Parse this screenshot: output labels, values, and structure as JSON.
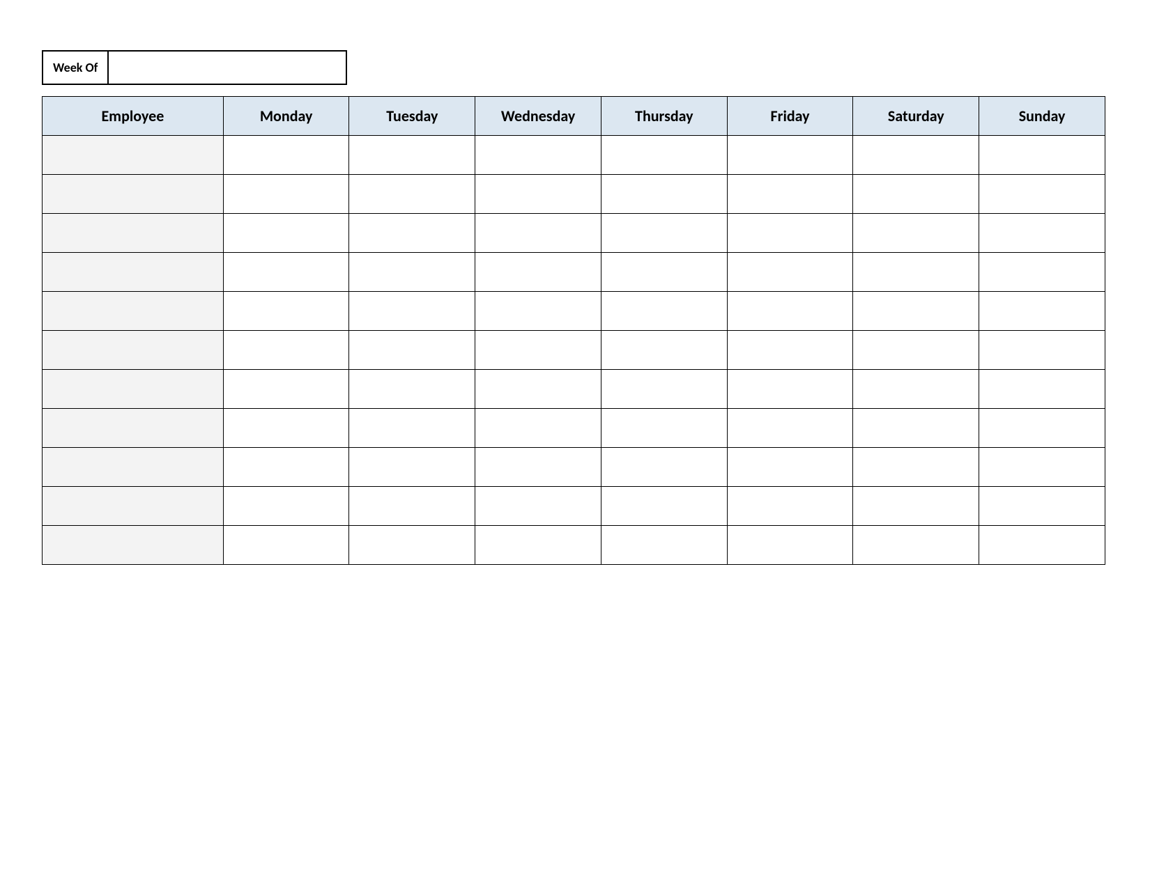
{
  "week_of": {
    "label": "Week Of",
    "value": ""
  },
  "columns": [
    "Employee",
    "Monday",
    "Tuesday",
    "Wednesday",
    "Thursday",
    "Friday",
    "Saturday",
    "Sunday"
  ],
  "rows": [
    {
      "employee": "",
      "monday": "",
      "tuesday": "",
      "wednesday": "",
      "thursday": "",
      "friday": "",
      "saturday": "",
      "sunday": ""
    },
    {
      "employee": "",
      "monday": "",
      "tuesday": "",
      "wednesday": "",
      "thursday": "",
      "friday": "",
      "saturday": "",
      "sunday": ""
    },
    {
      "employee": "",
      "monday": "",
      "tuesday": "",
      "wednesday": "",
      "thursday": "",
      "friday": "",
      "saturday": "",
      "sunday": ""
    },
    {
      "employee": "",
      "monday": "",
      "tuesday": "",
      "wednesday": "",
      "thursday": "",
      "friday": "",
      "saturday": "",
      "sunday": ""
    },
    {
      "employee": "",
      "monday": "",
      "tuesday": "",
      "wednesday": "",
      "thursday": "",
      "friday": "",
      "saturday": "",
      "sunday": ""
    },
    {
      "employee": "",
      "monday": "",
      "tuesday": "",
      "wednesday": "",
      "thursday": "",
      "friday": "",
      "saturday": "",
      "sunday": ""
    },
    {
      "employee": "",
      "monday": "",
      "tuesday": "",
      "wednesday": "",
      "thursday": "",
      "friday": "",
      "saturday": "",
      "sunday": ""
    },
    {
      "employee": "",
      "monday": "",
      "tuesday": "",
      "wednesday": "",
      "thursday": "",
      "friday": "",
      "saturday": "",
      "sunday": ""
    },
    {
      "employee": "",
      "monday": "",
      "tuesday": "",
      "wednesday": "",
      "thursday": "",
      "friday": "",
      "saturday": "",
      "sunday": ""
    },
    {
      "employee": "",
      "monday": "",
      "tuesday": "",
      "wednesday": "",
      "thursday": "",
      "friday": "",
      "saturday": "",
      "sunday": ""
    },
    {
      "employee": "",
      "monday": "",
      "tuesday": "",
      "wednesday": "",
      "thursday": "",
      "friday": "",
      "saturday": "",
      "sunday": ""
    }
  ]
}
